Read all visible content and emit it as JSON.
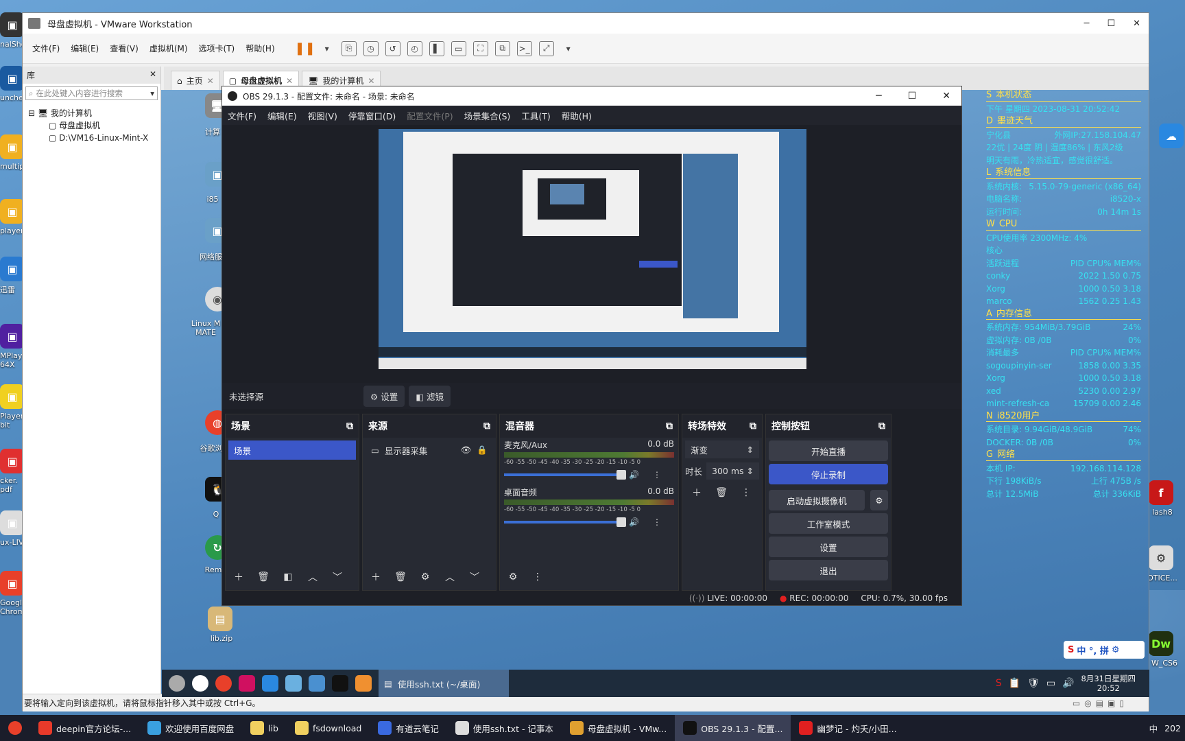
{
  "desktop": {
    "left_icons": [
      {
        "label": "nalSho"
      },
      {
        "label": "unche"
      },
      {
        "label": "multip"
      },
      {
        "label": "player"
      },
      {
        "label": "迅雷"
      },
      {
        "label": "MPlay\n64X"
      },
      {
        "label": "Player\nbit"
      },
      {
        "label": "cker.\npdf"
      },
      {
        "label": "ux-LIV"
      },
      {
        "label": "Googl\nChrom"
      }
    ],
    "guest_icons": [
      "计算",
      "i85",
      "网络服",
      "Linux M\nMATE",
      "谷歌浏",
      "Q",
      "Rem",
      "lib.zip"
    ],
    "right_icons": [
      "lash8",
      "OTICE...",
      "W_CS6"
    ]
  },
  "vmware": {
    "title": "母盘虚拟机 - VMware Workstation",
    "menu": [
      "文件(F)",
      "编辑(E)",
      "查看(V)",
      "虚拟机(M)",
      "选项卡(T)",
      "帮助(H)"
    ],
    "library_title": "库",
    "search_placeholder": "在此处键入内容进行搜索",
    "tree": {
      "root": "我的计算机",
      "children": [
        "母盘虚拟机",
        "D:\\VM16-Linux-Mint-X"
      ]
    },
    "tabs": [
      "主页",
      "母盘虚拟机",
      "我的计算机"
    ],
    "status_text": "要将输入定向到该虚拟机，请将鼠标指针移入其中或按 Ctrl+G。"
  },
  "obs": {
    "title": "OBS 29.1.3 - 配置文件: 未命名 - 场景: 未命名",
    "menu": [
      "文件(F)",
      "编辑(E)",
      "视图(V)",
      "停靠窗口(D)",
      "配置文件(P)",
      "场景集合(S)",
      "工具(T)",
      "帮助(H)"
    ],
    "no_source": "未选择源",
    "settings_btn": "设置",
    "filters_btn": "滤镜",
    "docks": {
      "scenes": {
        "title": "场景",
        "items": [
          "场景"
        ]
      },
      "sources": {
        "title": "来源",
        "items": [
          "显示器采集"
        ]
      },
      "mixer": {
        "title": "混音器",
        "channels": [
          {
            "name": "麦克风/Aux",
            "db": "0.0 dB"
          },
          {
            "name": "桌面音频",
            "db": "0.0 dB"
          }
        ],
        "scale": "-60 -55 -50 -45 -40 -35 -30 -25 -20 -15 -10 -5 0"
      },
      "transitions": {
        "title": "转场特效",
        "type": "渐变",
        "duration_label": "时长",
        "duration": "300 ms"
      },
      "controls": {
        "title": "控制按钮",
        "buttons": [
          "开始直播",
          "停止录制",
          "启动虚拟摄像机",
          "工作室模式",
          "设置",
          "退出"
        ]
      }
    },
    "status": {
      "live": "LIVE: 00:00:00",
      "rec": "REC: 00:00:00",
      "cpu": "CPU: 0.7%, 30.00 fps"
    }
  },
  "conky": {
    "sections": [
      {
        "key": "S",
        "title": "本机状态",
        "lines": [
          [
            "下午 星期四 2023-08-31 20:52:42",
            ""
          ]
        ]
      },
      {
        "key": "D",
        "title": "墨迹天气",
        "lines": [
          [
            "宁化县",
            "外网IP:27.158.104.47"
          ],
          [
            "22优 | 24度 阴 | 湿度86% | 东风2级",
            ""
          ],
          [
            "明天有雨，冷热适宜，感觉很舒适。",
            ""
          ]
        ]
      },
      {
        "key": "L",
        "title": "系统信息",
        "lines": [
          [
            "系统内核:",
            "5.15.0-79-generic (x86_64)"
          ],
          [
            "电脑名称:",
            "i8520-x"
          ],
          [
            "运行时间:",
            "0h 14m 1s"
          ]
        ]
      },
      {
        "key": "W",
        "title": "CPU",
        "lines": [
          [
            "CPU使用率 2300MHz: 4%",
            ""
          ],
          [
            "核心",
            ""
          ],
          [
            "活跃进程",
            "PID CPU% MEM%"
          ],
          [
            "conky",
            "2022 1.50 0.75"
          ],
          [
            "Xorg",
            "1000 0.50 3.18"
          ],
          [
            "marco",
            "1562 0.25 1.43"
          ]
        ]
      },
      {
        "key": "A",
        "title": "内存信息",
        "lines": [
          [
            "系统内存: 954MiB/3.79GiB",
            "24%"
          ],
          [
            "虚拟内存: 0B /0B",
            "0%"
          ],
          [
            "消耗最多",
            "PID CPU% MEM%"
          ],
          [
            "sogoupinyin-ser",
            "1858 0.00 3.35"
          ],
          [
            "Xorg",
            "1000 0.50 3.18"
          ],
          [
            "xed",
            "5230 0.00 2.97"
          ],
          [
            "mint-refresh-ca",
            "15709 0.00 2.46"
          ]
        ]
      },
      {
        "key": "N",
        "title": "i8520用户",
        "lines": [
          [
            "系统目录: 9.94GiB/48.9GiB",
            "74%"
          ],
          [
            "DOCKER: 0B /0B",
            "0%"
          ]
        ]
      },
      {
        "key": "G",
        "title": "网络",
        "lines": [
          [
            "本机 IP:",
            "192.168.114.128"
          ],
          [
            "下行 198KiB/s",
            "上行 475B /s"
          ],
          [
            "总计 12.5MiB",
            "总计 336KiB"
          ]
        ]
      }
    ]
  },
  "guest_taskbar": {
    "window": "使用ssh.txt (~/桌面)",
    "clock_date": "8月31日星期四",
    "clock_time": "20:52"
  },
  "ime": "中 °, 拼",
  "host_taskbar": {
    "items": [
      "deepin官方论坛-...",
      "欢迎使用百度网盘",
      "lib",
      "fsdownload",
      "有道云笔记",
      "使用ssh.txt - 记事本",
      "母盘虚拟机 - VMw...",
      "OBS 29.1.3 - 配置...",
      "幽梦记 - 灼夭/小田..."
    ],
    "tray": "中",
    "year": "202"
  }
}
